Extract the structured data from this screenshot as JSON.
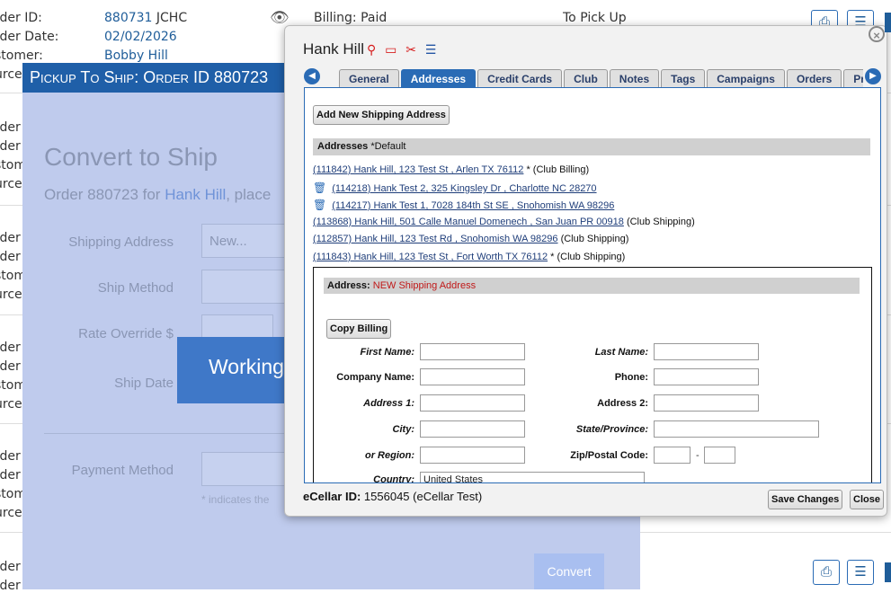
{
  "background": {
    "top_row": {
      "order_id_label": "rder ID:",
      "order_id": "880731",
      "order_code": "JCHC",
      "order_date_label": "rder Date:",
      "order_date": "02/02/2026",
      "customer_label": "stomer:",
      "customer": "Bobby Hill",
      "source_label": "urce",
      "billing_status": "Billing: Paid",
      "pickup_status": "To Pick Up"
    },
    "repeat_labels": [
      "rder I",
      "rder I",
      "stom",
      "urce"
    ],
    "row_icons": [
      "pdf-icon",
      "checklist-icon",
      "print-icon"
    ]
  },
  "pickup_modal": {
    "header": "Pickup To Ship: Order ID 880723",
    "title": "Convert to Ship",
    "subtitle_prefix": "Order 880723 for ",
    "subtitle_link": "Hank Hill",
    "subtitle_suffix": ", place",
    "fields": {
      "shipping_address_label": "Shipping Address",
      "shipping_address_value": "New...",
      "ship_method_label": "Ship Method",
      "rate_override_label": "Rate Override $",
      "ship_date_label": "Ship Date",
      "payment_method_label": "Payment Method"
    },
    "required_note": "* indicates the",
    "working_text": "Working",
    "convert_button": "Convert"
  },
  "customer_dialog": {
    "name": "Hank Hill",
    "header_icons": [
      "wine-icon",
      "credit-card-icon",
      "no-shipping-icon",
      "checklist-icon"
    ],
    "tabs": [
      {
        "label": "General",
        "active": false
      },
      {
        "label": "Addresses",
        "active": true
      },
      {
        "label": "Credit Cards",
        "active": false
      },
      {
        "label": "Club",
        "active": false
      },
      {
        "label": "Notes",
        "active": false
      },
      {
        "label": "Tags",
        "active": false
      },
      {
        "label": "Campaigns",
        "active": false
      },
      {
        "label": "Orders",
        "active": false
      },
      {
        "label": "Pro",
        "active": false
      }
    ],
    "add_address_button": "Add New Shipping Address",
    "addresses_section_title": "Addresses",
    "addresses_section_note": " *Default",
    "addresses": [
      {
        "link": "(111842) Hank Hill, 123 Test St , Arlen TX 76112",
        "suffix": " * (Club Billing)",
        "trash": false
      },
      {
        "link": "(114218) Hank Test 2, 325 Kingsley Dr , Charlotte NC 28270",
        "suffix": "",
        "trash": true
      },
      {
        "link": "(114217) Hank Test 1, 7028 184th St SE , Snohomish WA 98296",
        "suffix": "",
        "trash": true
      },
      {
        "link": "(113868) Hank Hill, 501 Calle Manuel Domenech , San Juan PR 00918",
        "suffix": " (Club Shipping)",
        "trash": false
      },
      {
        "link": "(112857) Hank Hill, 123 Test Rd , Snohomish WA 98296",
        "suffix": " (Club Shipping)",
        "trash": false
      },
      {
        "link": "(111843) Hank Hill, 123 Test St , Fort Worth TX 76112",
        "suffix": " * (Club Shipping)",
        "trash": false
      }
    ],
    "form": {
      "header_label": "Address:",
      "header_value": " NEW Shipping Address",
      "copy_billing_button": "Copy Billing",
      "first_name_label": "First Name:",
      "last_name_label": "Last Name:",
      "company_name_label": "Company Name:",
      "phone_label": "Phone:",
      "address1_label": "Address 1:",
      "address2_label": "Address 2:",
      "city_label": "City:",
      "state_label": "State/Province:",
      "region_label": "or Region:",
      "zip_label": "Zip/Postal Code:",
      "zip_separator": "-",
      "country_label": "Country:",
      "country_value": "United States"
    },
    "footer": {
      "ecellar_label": "eCellar ID:",
      "ecellar_value": " 1556045 (eCellar Test)",
      "save_button": "Save Changes",
      "close_button": "Close"
    }
  }
}
